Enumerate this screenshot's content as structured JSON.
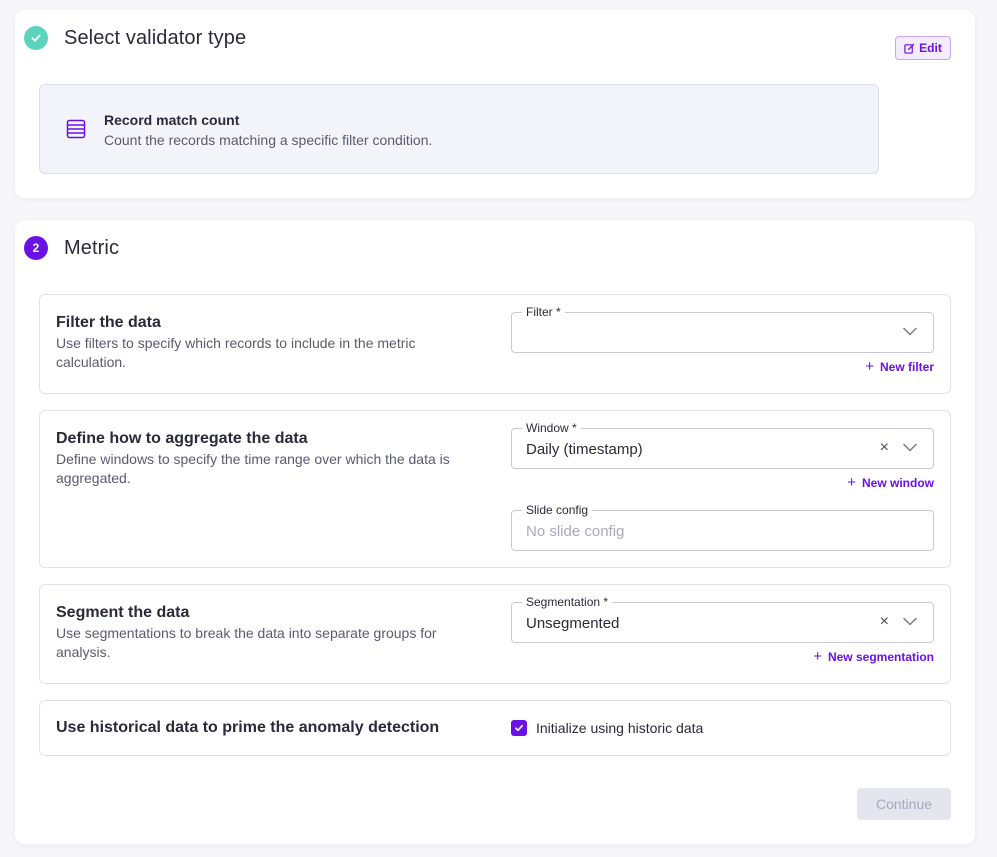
{
  "step1": {
    "title": "Select validator type",
    "edit_label": "Edit",
    "validator": {
      "title": "Record match count",
      "description": "Count the records matching a specific filter condition."
    }
  },
  "step2": {
    "number": "2",
    "title": "Metric"
  },
  "filter_section": {
    "title": "Filter the data",
    "description": "Use filters to specify which records to include in the metric calculation.",
    "field_label": "Filter *",
    "field_value": "",
    "add_label": "New filter"
  },
  "aggregate_section": {
    "title": "Define how to aggregate the data",
    "description": "Define windows to specify the time range over which the data is aggregated.",
    "window_label": "Window *",
    "window_value": "Daily (timestamp)",
    "add_label": "New window",
    "slide_label": "Slide config",
    "slide_placeholder": "No slide config"
  },
  "segment_section": {
    "title": "Segment the data",
    "description": "Use segmentations to break the data into separate groups for analysis.",
    "field_label": "Segmentation *",
    "field_value": "Unsegmented",
    "add_label": "New segmentation"
  },
  "historic_section": {
    "title": "Use historical data to prime the anomaly detection",
    "checkbox_label": "Initialize using historic data",
    "checked": true
  },
  "continue_label": "Continue",
  "colors": {
    "accent": "#6a11e6",
    "done": "#5dd3bd"
  }
}
